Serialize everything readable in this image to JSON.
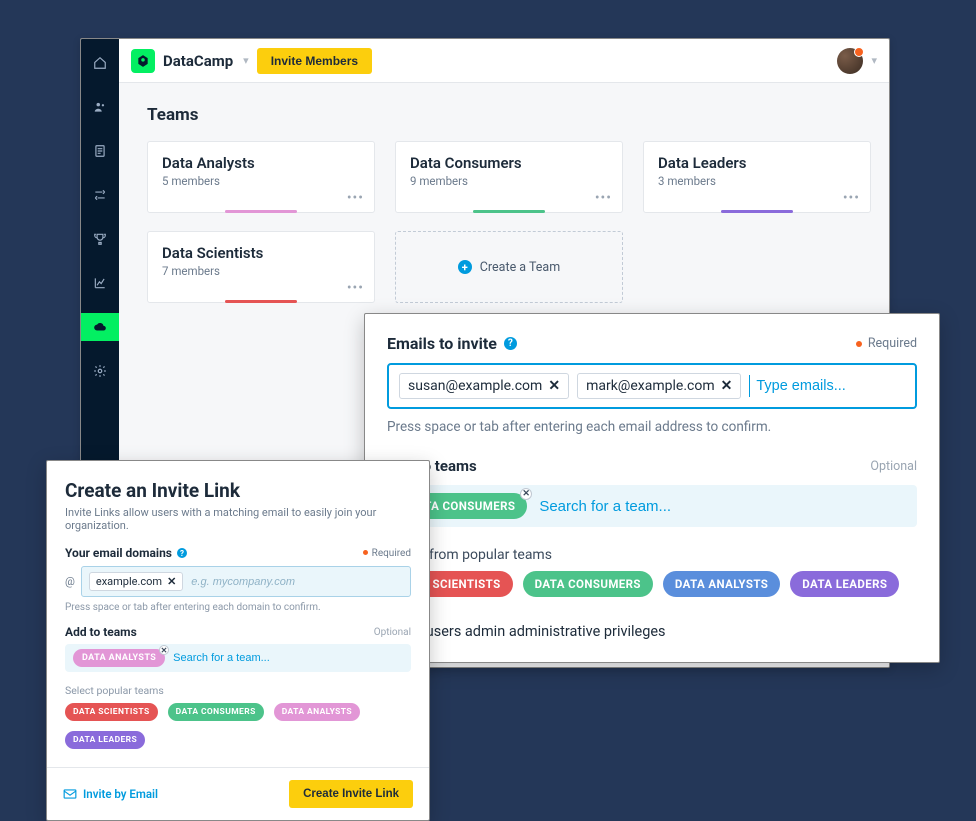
{
  "topbar": {
    "org": "DataCamp",
    "invite_btn": "Invite Members"
  },
  "page": {
    "title": "Teams",
    "create_label": "Create a Team"
  },
  "teams": [
    {
      "name": "Data Analysts",
      "members": "5 members",
      "color": "c-pink"
    },
    {
      "name": "Data Consumers",
      "members": "9 members",
      "color": "c-green"
    },
    {
      "name": "Data Leaders",
      "members": "3 members",
      "color": "c-purple"
    },
    {
      "name": "Data Scientists",
      "members": "7 members",
      "color": "c-red"
    }
  ],
  "emails_modal": {
    "title": "Emails to invite",
    "required": "Required",
    "chips": [
      "susan@example.com",
      "mark@example.com"
    ],
    "placeholder": "Type emails...",
    "hint": "Press space or tab after entering each email address to confirm.",
    "add_teams_title": "Add to teams",
    "optional": "Optional",
    "selected_team": "DATA CONSUMERS",
    "selected_team_color": "c-green",
    "team_search_ph": "Search for a team...",
    "popular_title": "Select from popular teams",
    "popular": [
      {
        "label": "DATA SCIENTISTS",
        "color": "c-red"
      },
      {
        "label": "DATA CONSUMERS",
        "color": "c-green"
      },
      {
        "label": "DATA ANALYSTS",
        "color": "c-blue"
      },
      {
        "label": "DATA LEADERS",
        "color": "c-purple"
      }
    ],
    "admin_line": "Grant users admin administrative privileges"
  },
  "link_modal": {
    "title": "Create an Invite Link",
    "desc": "Invite Links allow users with a matching email to easily join your organization.",
    "domains_title": "Your email domains",
    "required": "Required",
    "at": "@",
    "domain_chip": "example.com",
    "domain_ph": "e.g. mycompany.com",
    "hint": "Press space or tab after entering each domain to confirm.",
    "add_teams_title": "Add to teams",
    "optional": "Optional",
    "selected_team": "DATA ANALYSTS",
    "selected_team_color": "c-pink",
    "team_search_ph": "Search for a team...",
    "popular_title": "Select popular teams",
    "popular": [
      {
        "label": "DATA SCIENTISTS",
        "color": "c-red"
      },
      {
        "label": "DATA CONSUMERS",
        "color": "c-green"
      },
      {
        "label": "DATA ANALYSTS",
        "color": "c-pink"
      },
      {
        "label": "DATA LEADERS",
        "color": "c-purple"
      }
    ],
    "invite_by_email": "Invite by Email",
    "create_btn": "Create Invite Link"
  }
}
